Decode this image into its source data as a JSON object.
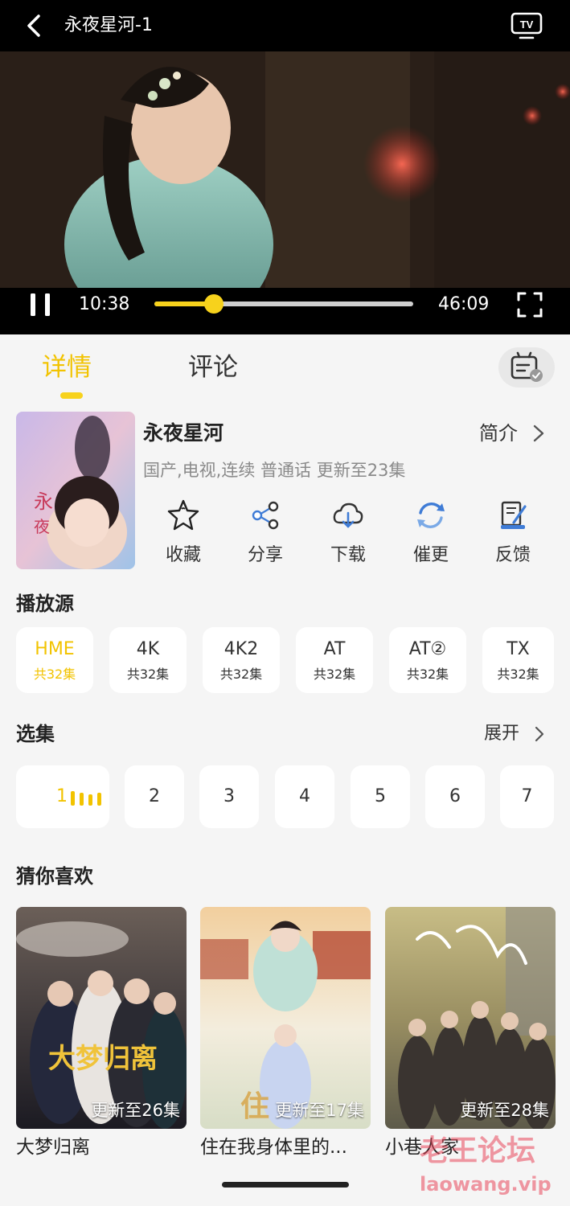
{
  "header": {
    "title": "永夜星河-1",
    "back_icon": "back-arrow-icon",
    "tv_icon": "tv-cast-icon"
  },
  "player": {
    "current_time": "10:38",
    "total_time": "46:09",
    "progress": 0.23,
    "accent": "#f7d21c"
  },
  "tabs": [
    {
      "label": "详情",
      "active": true
    },
    {
      "label": "评论",
      "active": false
    }
  ],
  "show": {
    "title": "永夜星河",
    "intro_label": "简介",
    "meta": "国产,电视,连续 普通话 更新至23集"
  },
  "actions": [
    {
      "label": "收藏",
      "icon": "star-icon"
    },
    {
      "label": "分享",
      "icon": "share-icon"
    },
    {
      "label": "下载",
      "icon": "cloud-download-icon"
    },
    {
      "label": "催更",
      "icon": "refresh-icon"
    },
    {
      "label": "反馈",
      "icon": "feedback-icon"
    }
  ],
  "sources_section": {
    "title": "播放源",
    "items": [
      {
        "name": "HME",
        "count": "共32集",
        "active": true
      },
      {
        "name": "4K",
        "count": "共32集",
        "active": false
      },
      {
        "name": "4K2",
        "count": "共32集",
        "active": false
      },
      {
        "name": "AT",
        "count": "共32集",
        "active": false
      },
      {
        "name": "AT②",
        "count": "共32集",
        "active": false
      },
      {
        "name": "TX",
        "count": "共32集",
        "active": false
      }
    ]
  },
  "episodes_section": {
    "title": "选集",
    "expand_label": "展开",
    "items": [
      "1",
      "2",
      "3",
      "4",
      "5",
      "6",
      "7"
    ],
    "active_index": 0
  },
  "recommend_section": {
    "title": "猜你喜欢",
    "items": [
      {
        "title": "大梦归离",
        "badge": "更新至26集"
      },
      {
        "title": "住在我身体里的...",
        "badge": "更新至17集"
      },
      {
        "title": "小巷人家",
        "badge": "更新至28集"
      }
    ]
  },
  "watermark": {
    "line1": "老王论坛",
    "line2": "laowang.vip"
  }
}
